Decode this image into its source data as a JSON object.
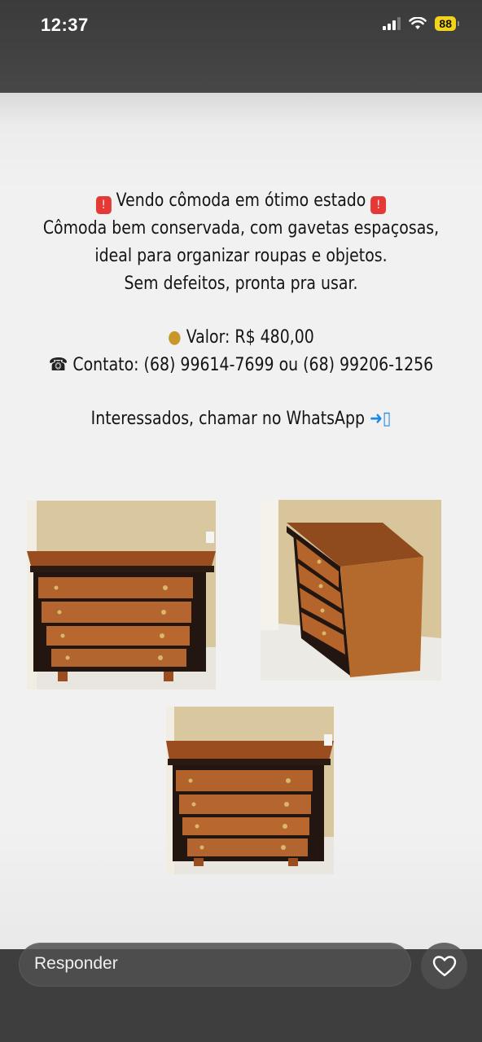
{
  "status_bar": {
    "time": "12:37",
    "battery_level": "88",
    "battery_color": "#f2d31b",
    "icons": [
      "signal-icon",
      "wifi-icon",
      "battery-icon"
    ]
  },
  "story": {
    "lines": [
      "Vendo cômoda em ótimo estado",
      "Cômoda bem conservada, com gavetas espaçosas,",
      "ideal para organizar roupas e objetos.",
      "Sem defeitos, pronta pra usar.",
      "Valor: R$ 480,00",
      "Contato: (68) 99614-7699 ou (68) 99206-1256",
      "Interessados, chamar no WhatsApp"
    ],
    "icons": [
      "siren-icon",
      "money-bag-icon",
      "telephone-icon",
      "mobile-phone-arrow-icon"
    ],
    "photos": [
      "dresser-front-photo",
      "dresser-side-photo",
      "dresser-wide-photo"
    ]
  },
  "reply_bar": {
    "placeholder": "Responder",
    "like_icon": "heart-icon"
  }
}
